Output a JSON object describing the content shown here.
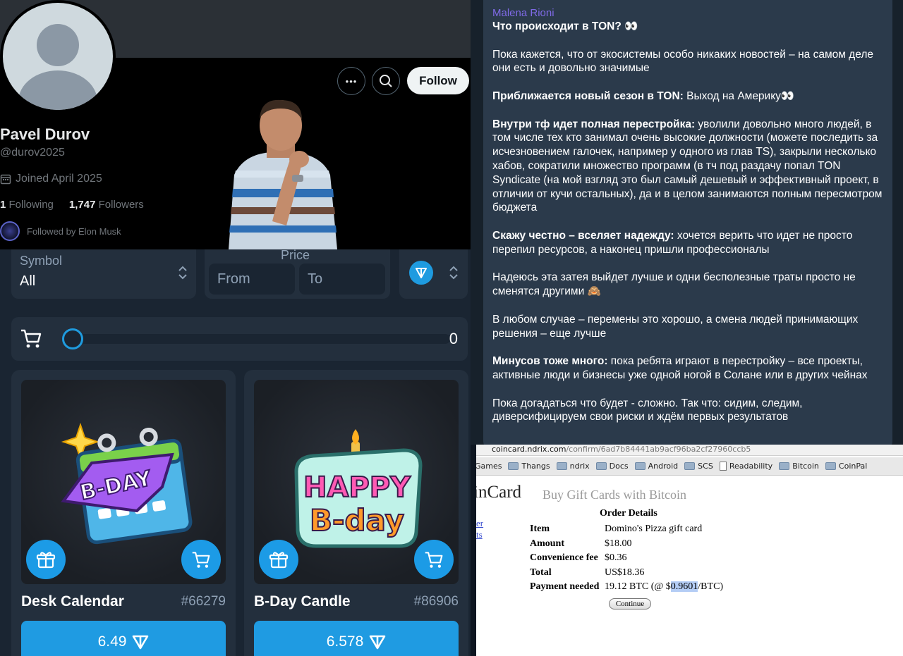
{
  "profile": {
    "name": "Pavel Durov",
    "handle": "@durov2025",
    "joined": "Joined April 2025",
    "following_count": "1",
    "following_label": "Following",
    "followers_count": "1,747",
    "followers_label": "Followers",
    "followed_by": "Followed by Elon Musk",
    "follow_label": "Follow",
    "more_label": "•••"
  },
  "market": {
    "symbol_label": "Symbol",
    "symbol_value": "All",
    "price_label": "Price",
    "from_placeholder": "From",
    "to_placeholder": "To",
    "cart_count": "0",
    "items": [
      {
        "title": "Desk Calendar",
        "number": "#66279",
        "price": "6.49",
        "art_text": "B-DAY"
      },
      {
        "title": "B-Day Candle",
        "number": "#86906",
        "price": "6.578",
        "art_text_1": "HAPPY",
        "art_text_2": "B-day"
      }
    ]
  },
  "telegram": {
    "author": "Malena Rioni",
    "p1_bold": "Что происходит в TON? 👀",
    "p2": "Пока кажется, что от экосистемы особо никаких новостей – на самом деле они есть и довольно значимые",
    "p3_bold": "Приближается новый сезон в TON:",
    "p3": " Выход на Америку👀",
    "p4_bold": "Внутри тф идет полная перестройка:",
    "p4": " уволили довольно много людей, в том числе тех кто занимал очень высокие должности (можете последить за исчезновением галочек, например у одного из глав TS), закрыли несколько хабов, сократили множество программ (в тч под раздачу попал TON Syndicate (на мой взгляд это был самый дешевый и эффективный проект, в отличии от кучи остальных), да и в целом занимаются полным пересмотром бюджета",
    "p5_bold": "Скажу честно – вселяет надежду:",
    "p5": " хочется верить что идет не просто перепил ресурсов, а наконец пришли профессионалы",
    "p6": "Надеюсь эта затея выйдет лучше и одни бесполезные траты просто не сменятся другими 🙈",
    "p7": "В любом случае – перемены это хорошо, а смена людей принимающих решения – еще лучше",
    "p8_bold": "Минусов тоже много:",
    "p8": " пока ребята играют в перестройку – все проекты, активные люди и бизнесы уже одной ногой в Солане или в других чейнах",
    "p9": "Пока догадаться что будет - сложно. Так что: сидим, следим, диверсифицируем свои риски и ждём первых результатов"
  },
  "browser": {
    "url_host": "coincard.ndrix.com",
    "url_path": "/confirm/6ad7b84441ab9acf96ba2cf27960ccb5",
    "bookmarks": [
      "Games",
      "Thangs",
      "ndrix",
      "Docs",
      "Android",
      "SCS",
      "Readability",
      "Bitcoin",
      "CoinPal"
    ],
    "site_title": "inCard",
    "site_tagline": "Buy Gift Cards with Bitcoin",
    "side_link_1": "er",
    "side_link_2": "ts",
    "order_heading": "Order Details",
    "rows": [
      {
        "k": "Item",
        "v": "Domino's Pizza gift card"
      },
      {
        "k": "Amount",
        "v": "$18.00"
      },
      {
        "k": "Convenience fee",
        "v": "$0.36"
      },
      {
        "k": "Total",
        "v": "US$18.36"
      }
    ],
    "payment_label": "Payment needed",
    "payment_pre": "19.12 BTC (@ $",
    "payment_hl": "0.9601",
    "payment_post": "/BTC)",
    "continue_label": "Continue"
  },
  "colors": {
    "ton_blue": "#1f9be2",
    "tg_author": "#7f6ae6",
    "x_bg": "#000000",
    "market_bg": "#1a2532"
  }
}
